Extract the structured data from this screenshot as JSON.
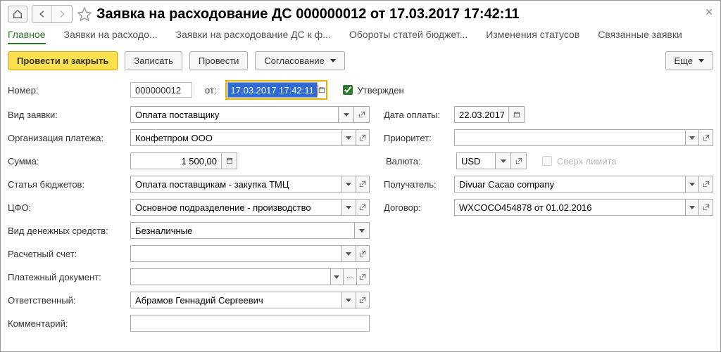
{
  "header": {
    "title": "Заявка на расходование ДС 000000012 от 17.03.2017 17:42:11"
  },
  "tabs": {
    "main": "Главное",
    "requests": "Заявки на расходо...",
    "requests_full": "Заявки на расходование ДС к ф...",
    "turnovers": "Обороты статей бюджет...",
    "status_changes": "Изменения статусов",
    "related": "Связанные заявки"
  },
  "toolbar": {
    "post_close": "Провести и закрыть",
    "save": "Записать",
    "post": "Провести",
    "approval": "Согласование",
    "more": "Еще"
  },
  "labels": {
    "number": "Номер:",
    "from": "от:",
    "approved": "Утвержден",
    "request_type": "Вид заявки:",
    "payment_date": "Дата оплаты:",
    "org": "Организация платежа:",
    "priority": "Приоритет:",
    "sum": "Сумма:",
    "currency": "Валюта:",
    "over_limit": "Сверх лимита",
    "budget_item": "Статья бюджетов:",
    "recipient": "Получатель:",
    "cfo": "ЦФО:",
    "contract": "Договор:",
    "money_type": "Вид денежных средств:",
    "account": "Расчетный счет:",
    "pay_doc": "Платежный документ:",
    "responsible": "Ответственный:",
    "comment": "Комментарий:"
  },
  "values": {
    "number": "000000012",
    "date": "17.03.2017 17:42:11",
    "request_type": "Оплата поставщику",
    "payment_date": "22.03.2017",
    "org": "Конфетпром ООО",
    "priority": "",
    "sum": "1 500,00",
    "currency": "USD",
    "budget_item": "Оплата поставщикам - закупка ТМЦ",
    "recipient": "Divuar Cacao company",
    "cfo": "Основное подразделение - производство",
    "contract": "WXCOCO454878 от 01.02.2016",
    "money_type": "Безналичные",
    "account": "",
    "pay_doc": "",
    "responsible": "Абрамов Геннадий Сергеевич",
    "comment": ""
  },
  "state": {
    "approved_checked": true
  }
}
